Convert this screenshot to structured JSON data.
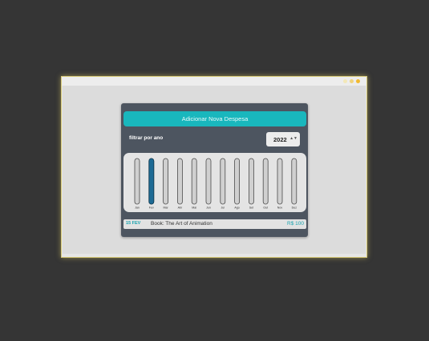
{
  "app": {
    "add_button_label": "Adicionar Nova Despesa",
    "filter_label": "filtrar por ano",
    "year_selected": "2022"
  },
  "colors": {
    "accent": "#19b7bd",
    "bar_fill": "#1d6a94",
    "card_bg": "#4d5560"
  },
  "chart_data": {
    "type": "bar",
    "categories": [
      "Jan",
      "Fev",
      "Mar",
      "Abr",
      "Mai",
      "Jun",
      "Jul",
      "Ago",
      "Set",
      "Out",
      "Nov",
      "Dez"
    ],
    "values": [
      0,
      100,
      0,
      0,
      0,
      0,
      0,
      0,
      0,
      0,
      0,
      0
    ],
    "ylim": [
      0,
      100
    ]
  },
  "expenses": [
    {
      "date": "15 FEV",
      "title": "Book: The Art of Animation",
      "amount": "R$ 100"
    }
  ]
}
